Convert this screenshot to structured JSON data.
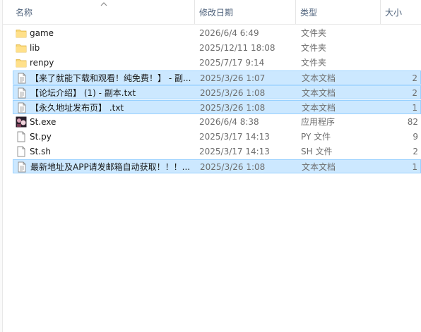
{
  "columns": {
    "name": "名称",
    "date": "修改日期",
    "type": "类型",
    "size": "大小"
  },
  "files": [
    {
      "icon": "folder-icon",
      "name": "game",
      "date": "2026/6/4 6:49",
      "type": "文件夹",
      "size": "",
      "selected": false
    },
    {
      "icon": "folder-icon",
      "name": "lib",
      "date": "2025/12/11 18:08",
      "type": "文件夹",
      "size": "",
      "selected": false
    },
    {
      "icon": "folder-icon",
      "name": "renpy",
      "date": "2025/7/17 9:14",
      "type": "文件夹",
      "size": "",
      "selected": false
    },
    {
      "icon": "text-file-icon",
      "name": "【来了就能下载和观看！纯免费！】 - 副...",
      "date": "2025/3/26 1:07",
      "type": "文本文档",
      "size": "2",
      "selected": true
    },
    {
      "icon": "text-file-icon",
      "name": "【论坛介绍】 (1) - 副本.txt",
      "date": "2025/3/26 1:08",
      "type": "文本文档",
      "size": "2",
      "selected": true
    },
    {
      "icon": "text-file-icon",
      "name": "【永久地址发布页】 .txt",
      "date": "2025/3/26 1:08",
      "type": "文本文档",
      "size": "1",
      "selected": true
    },
    {
      "icon": "exe-app-icon",
      "name": "St.exe",
      "date": "2026/6/4 8:38",
      "type": "应用程序",
      "size": "82",
      "selected": false
    },
    {
      "icon": "blank-file-icon",
      "name": "St.py",
      "date": "2025/3/17 14:13",
      "type": "PY 文件",
      "size": "9",
      "selected": false
    },
    {
      "icon": "blank-file-icon",
      "name": "St.sh",
      "date": "2025/3/17 14:13",
      "type": "SH 文件",
      "size": "2",
      "selected": false
    },
    {
      "icon": "text-file-icon",
      "name": "最新地址及APP请发邮箱自动获取！！！...",
      "date": "2025/3/26 1:08",
      "type": "文本文档",
      "size": "1",
      "selected": true
    }
  ]
}
